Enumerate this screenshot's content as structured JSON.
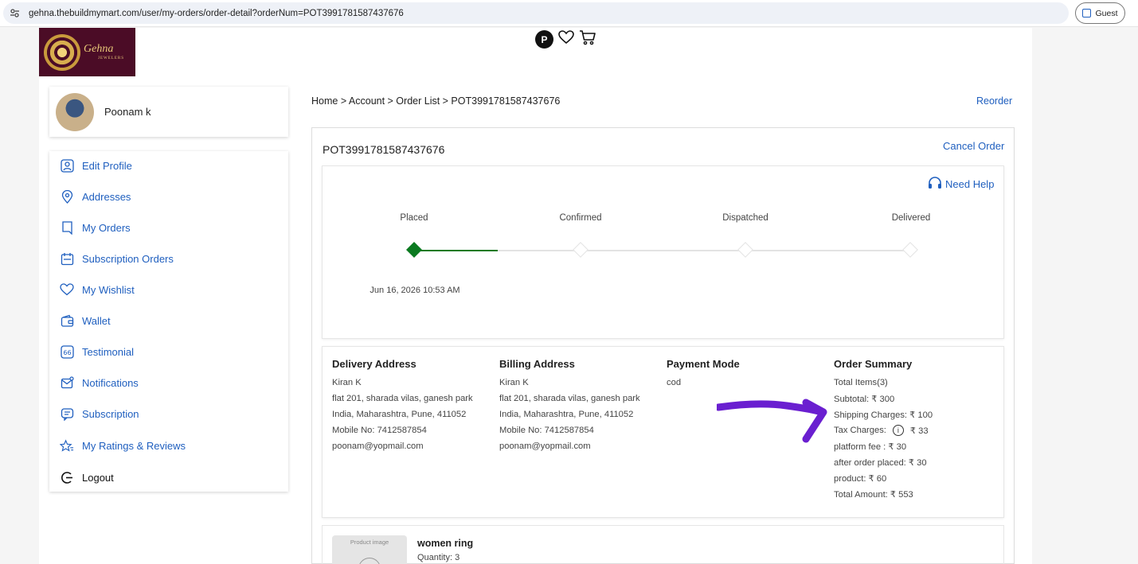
{
  "browser": {
    "url": "gehna.thebuildmymart.com/user/my-orders/order-detail?orderNum=POT3991781587437676",
    "profile_label": "Guest"
  },
  "header": {
    "logo_text": "Gehna",
    "logo_subtext": "JEWELERS",
    "badge_letter": "P"
  },
  "user": {
    "name": "Poonam k"
  },
  "sidebar": {
    "items": [
      {
        "label": "Edit Profile",
        "icon": "user-icon"
      },
      {
        "label": "Addresses",
        "icon": "location-icon"
      },
      {
        "label": "My Orders",
        "icon": "orders-icon"
      },
      {
        "label": "Subscription Orders",
        "icon": "calendar-icon"
      },
      {
        "label": "My Wishlist",
        "icon": "heart-icon"
      },
      {
        "label": "Wallet",
        "icon": "wallet-icon"
      },
      {
        "label": "Testimonial",
        "icon": "quote-icon"
      },
      {
        "label": "Notifications",
        "icon": "mail-icon"
      },
      {
        "label": "Subscription",
        "icon": "subscription-icon"
      },
      {
        "label": "My Ratings & Reviews",
        "icon": "star-icon"
      },
      {
        "label": "Logout",
        "icon": "logout-icon"
      }
    ]
  },
  "breadcrumb": "Home > Account > Order List > POT3991781587437676",
  "reorder_label": "Reorder",
  "order": {
    "id": "POT3991781587437676",
    "cancel_label": "Cancel Order",
    "need_help_label": "Need Help",
    "steps": [
      {
        "label": "Placed",
        "done": true,
        "date": "Jun 16, 2026 10:53 AM"
      },
      {
        "label": "Confirmed",
        "done": false,
        "date": ""
      },
      {
        "label": "Dispatched",
        "done": false,
        "date": ""
      },
      {
        "label": "Delivered",
        "done": false,
        "date": ""
      }
    ],
    "delivery": {
      "title": "Delivery Address",
      "name": "Kiran K",
      "line1": "flat 201, sharada vilas, ganesh park",
      "line2": "India, Maharashtra, Pune, 411052",
      "mobile": "Mobile No: 7412587854",
      "email": "poonam@yopmail.com"
    },
    "billing": {
      "title": "Billing Address",
      "name": "Kiran K",
      "line1": "flat 201, sharada vilas, ganesh park",
      "line2": "India, Maharashtra, Pune, 411052",
      "mobile": "Mobile No: 7412587854",
      "email": "poonam@yopmail.com"
    },
    "payment": {
      "title": "Payment Mode",
      "value": "cod"
    },
    "summary": {
      "title": "Order Summary",
      "total_items": "Total Items(3)",
      "subtotal": "Subtotal: ₹ 300",
      "shipping": "Shipping Charges: ₹ 100",
      "tax_label": "Tax Charges:",
      "tax_value": "₹ 33",
      "platform_fee": "platform fee : ₹ 30",
      "after_order": "after order placed: ₹ 30",
      "product": "product: ₹ 60",
      "total": "Total Amount: ₹ 553"
    },
    "product": {
      "image_placeholder": "Product image",
      "name": "women ring",
      "quantity": "Quantity: 3"
    }
  },
  "colors": {
    "link": "#1f5fbf",
    "done_step": "#0b7a20",
    "annotation_arrow": "#6a1fd0",
    "logo_bg": "#4b0c26"
  }
}
